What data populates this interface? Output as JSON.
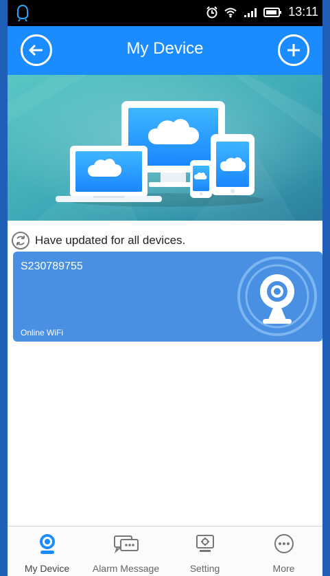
{
  "status_bar": {
    "time": "13:11"
  },
  "header": {
    "title": "My Device"
  },
  "update_message": "Have updated for all devices.",
  "device": {
    "id": "S230789755",
    "status": "Online WiFi"
  },
  "tabs": [
    {
      "label": "My Device",
      "icon": "camera-icon"
    },
    {
      "label": "Alarm Message",
      "icon": "chat-icon"
    },
    {
      "label": "Setting",
      "icon": "monitor-gear-icon"
    },
    {
      "label": "More",
      "icon": "more-icon"
    }
  ],
  "colors": {
    "header_blue": "#1a8cff",
    "card_blue": "#4a90e2",
    "frame_blue": "#1f5fb8"
  }
}
